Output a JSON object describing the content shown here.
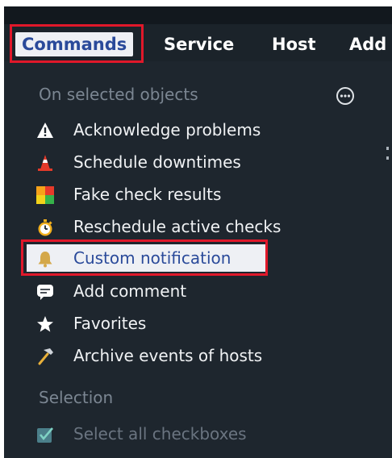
{
  "menubar": {
    "tabs": [
      {
        "label": "Commands",
        "active": true
      },
      {
        "label": "Service"
      },
      {
        "label": "Host"
      },
      {
        "label": "Add"
      }
    ]
  },
  "commands_menu": {
    "section_title": "On selected objects",
    "more_icon": "ellipsis-circle-icon",
    "items": [
      {
        "label": "Acknowledge problems",
        "icon": "warning-triangle-icon"
      },
      {
        "label": "Schedule downtimes",
        "icon": "traffic-cone-icon"
      },
      {
        "label": "Fake check results",
        "icon": "status-squares-icon"
      },
      {
        "label": "Reschedule active checks",
        "icon": "stopwatch-icon"
      },
      {
        "label": "Custom notification",
        "icon": "bell-icon",
        "selected": true
      },
      {
        "label": "Add comment",
        "icon": "speech-bubble-icon"
      },
      {
        "label": "Favorites",
        "icon": "star-icon"
      },
      {
        "label": "Archive events of hosts",
        "icon": "hammer-icon"
      }
    ],
    "selection_title": "Selection",
    "selection_items": [
      {
        "label": "Select all checkboxes",
        "icon": "checkbox-icon",
        "disabled": true
      }
    ]
  },
  "colors": {
    "background": "#1e262e",
    "highlight": "#e0182a",
    "active_tab_text": "#2a4a9a"
  }
}
